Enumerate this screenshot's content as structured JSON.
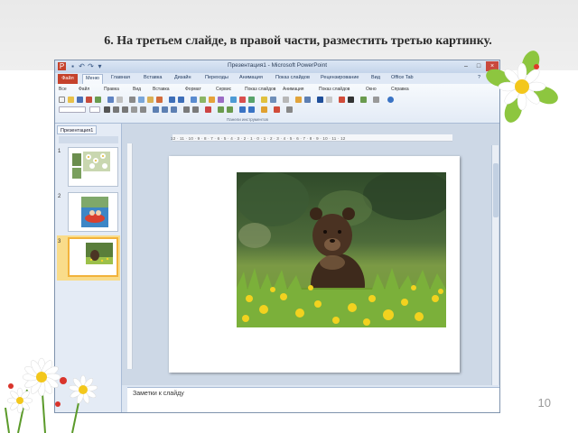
{
  "instruction": "6. На третьем слайде, в правой части, разместить третью картинку.",
  "page_number": "10",
  "window": {
    "title": "Презентация1 - Microsoft PowerPoint"
  },
  "ribbon": {
    "file_tab": "Файл",
    "tabs": [
      "Меню",
      "Главная",
      "Вставка",
      "Дизайн",
      "Переходы",
      "Анимация",
      "Показ слайдов",
      "Рецензирование",
      "Вид",
      "Office Tab"
    ],
    "menu_items": [
      "Все",
      "Файл",
      "Правка",
      "Вид",
      "Вставка",
      "Формат",
      "Сервис",
      "Показ слайдов",
      "Анимация",
      "Показ слайдов",
      "Окно",
      "Справка"
    ],
    "group_label": "Панели инструментов"
  },
  "ruler_text": "12 · 11 · 10 · 9 · 8 · 7 · 6 · 5 · 4 · 3 · 2 · 1 · 0 · 1 · 2 · 3 · 4 · 5 · 6 · 7 · 8 · 9 · 10 · 11 · 12",
  "slides_pane": {
    "tab_label": "Презентация1",
    "close_label": "×",
    "slide_numbers": [
      "1",
      "2",
      "3"
    ],
    "selected_slide": "3"
  },
  "notes_placeholder": "Заметки к слайду"
}
